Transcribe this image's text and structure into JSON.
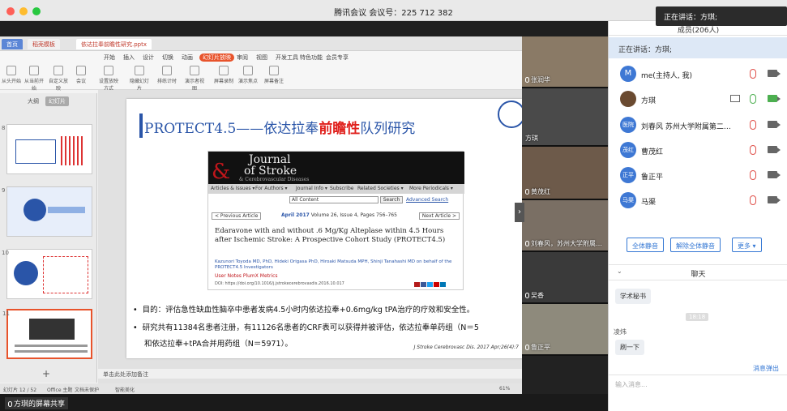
{
  "meeting": {
    "title": "腾讯会议 会议号：225 712 382",
    "speaking_label": "正在讲话：方琪;"
  },
  "ppt": {
    "tabs": [
      "首页",
      "稻壳模板",
      "依达拉奉前瞻性研究.pptx"
    ],
    "menu": [
      "开始",
      "插入",
      "设计",
      "切换",
      "动画",
      "放映",
      "审阅",
      "视图",
      "开发工具",
      "特色功能",
      "会员专享"
    ],
    "active_menu": "幻灯片放映",
    "ribbon": [
      "从头开始",
      "从当前开始",
      "自定义放映",
      "会议",
      "设置放映方式",
      "隐藏幻灯片",
      "排练计时",
      "演示者视图",
      "屏幕录制",
      "演示焦点",
      "屏幕备注"
    ],
    "outline_tabs": [
      "大纲",
      "幻灯片"
    ],
    "thumb_numbers": [
      "8",
      "9",
      "10",
      "11"
    ],
    "notes_placeholder": "单击此处添加备注",
    "status": [
      "幻灯片 12 / 52",
      "Office 主题",
      "文档未保护",
      "智能美化"
    ],
    "zoom": "61%"
  },
  "slide": {
    "title_prefix": "PROTECT4.5——依达拉奉",
    "title_highlight": "前瞻性",
    "title_suffix": "队列研究",
    "journal": {
      "logo_line1": "Journal",
      "logo_line2": "of Stroke",
      "logo_line3": "& Cerebrovascular Diseases",
      "nav": [
        "Articles & Issues ▾",
        "For Authors ▾",
        "Journal Info ▾",
        "Subscribe",
        "Related Societies ▾",
        "More Periodicals ▾"
      ],
      "search_value": "All Content",
      "search_button": "Search",
      "advanced": "Advanced Search",
      "prev": "< Previous Article",
      "issue_month": "April 2017",
      "issue_rest": "Volume 26, Issue 4, Pages 756–765",
      "next": "Next Article >",
      "article_title": "Edaravone with and without .6 Mg/Kg Alteplase within 4.5 Hours after Ischemic Stroke: A Prospective Cohort Study (PROTECT4.5)",
      "authors": "Kazunori Toyoda MD, PhD, Hideki Origasa PhD, Hiroaki Matsuda MPH, Shinji Tanahashi MD on behalf of the PROTECT4.5 Investigators",
      "user_notes": "User Notes    PlumX Metrics",
      "doi": "DOI: https://doi.org/10.1016/j.jstrokecerebrovasdis.2016.10.017"
    },
    "bullets": [
      "目的：评估急性缺血性脑卒中患者发病4.5小时内依达拉奉+0.6mg/kg tPA治疗的疗效和安全性。",
      "研究共有11384名患者注册，有11126名患者的CRF表可以获得并被评估，依达拉奉单药组（N＝5",
      "和依达拉奉+tPA合并用药组（N＝5971）。"
    ],
    "credit": "J Stroke Cerebrovasc Dis. 2017 Apr;26(4):7"
  },
  "share_footer": "方琪的屏幕共享",
  "videos": [
    {
      "name": "张润华",
      "color": "#8a7a66"
    },
    {
      "name": "方琪",
      "color": "#4a4a4a"
    },
    {
      "name": "黄茂红",
      "color": "#6d5a4a"
    },
    {
      "name": "刘春风，苏州大学附属…",
      "color": "#7a6f64"
    },
    {
      "name": "吴香",
      "color": "#3a3a3a"
    },
    {
      "name": "鲁正平",
      "color": "#8e8a7c"
    }
  ],
  "panel": {
    "header": "成员(206人)",
    "speaking": "正在讲话：方琪;",
    "members": [
      {
        "name": "me(主持人, 我)",
        "avatar": "M",
        "color": "#3e78d4",
        "cam": false
      },
      {
        "name": "方琪",
        "avatar": "",
        "color": "#6a4a30",
        "cam": true
      },
      {
        "name": "刘春风 苏州大学附属第二…",
        "avatar": "医院",
        "color": "#3e78d4",
        "cam": false
      },
      {
        "name": "曹茂红",
        "avatar": "茂红",
        "color": "#3e78d4",
        "cam": false
      },
      {
        "name": "鲁正平",
        "avatar": "正平",
        "color": "#3e78d4",
        "cam": false
      },
      {
        "name": "马渠",
        "avatar": "马渠",
        "color": "#3e78d4",
        "cam": false
      }
    ],
    "btn_mute_all": "全体静音",
    "btn_unmute_all": "解除全体静音",
    "btn_more": "更多 ▾",
    "chat_header": "聊天",
    "chat_bubble1": "学术秘书",
    "chat_time": "18:18",
    "chat_sender": "凌炜",
    "chat_bubble2": "刷一下",
    "chat_send": "消息弹出",
    "chat_input_placeholder": "输入消息..."
  }
}
